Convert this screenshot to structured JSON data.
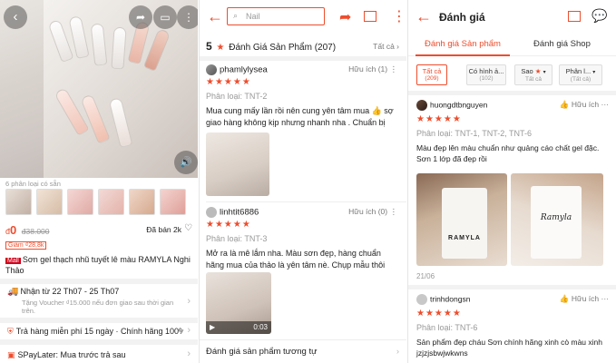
{
  "product": {
    "variant_count_label": "6 phân loại có sẵn",
    "price": "0",
    "price_currency": "đ",
    "original_price": "38.000",
    "original_currency": "đ",
    "sold": "Đã bán 2k",
    "discount_badge": "Giảm ₫28,8k",
    "mall_badge": "Mall",
    "title": "Sơn gel thạch nhũ tuyết lê màu RAMYLA Nghi Thảo",
    "shipping_title": "Nhận từ 22 Th07 - 25 Th07",
    "shipping_sub": "Tặng Voucher ₫15.000 nếu đơn giao sau thời gian trên.",
    "returns": "Trả hàng miễn phí 15 ngày · Chính hãng 100%...",
    "spaylater": "SPayLater: Mua trước trả sau"
  },
  "reviews_page": {
    "search_placeholder": "Nail",
    "rating": "5",
    "heading": "Đánh Giá Sản Phẩm (207)",
    "see_all": "Tất cả",
    "reviews": [
      {
        "user": "phamlylysea",
        "helpful": "Hữu ích (1)",
        "variant": "Phân loại: TNT-2",
        "text": "Mua cung mấy lần rồi nên cung yên tâm mua 👍 sợ giao hàng không kịp nhưng nhanh nha . Chuẩn bị hà..."
      },
      {
        "user": "linhtit6886",
        "helpful": "Hữu ích (0)",
        "variant": "Phân loại: TNT-3",
        "text": "Mở ra là mê lắm nha. Màu sơn đẹp, hàng chuẩn hãng mua của thảo là yên tâm nè. Chụp mẫu thôi chứ mua...",
        "video_duration": "0:03"
      }
    ],
    "similar": "Đánh giá sản phẩm tương tự"
  },
  "reviews_detail": {
    "title": "Đánh giá",
    "tab_product": "Đánh giá Sản phẩm",
    "tab_shop": "Đánh giá Shop",
    "chips": [
      {
        "label": "Tất cả",
        "sub": "(209)"
      },
      {
        "label": "Có hình ả...",
        "sub": "(102)"
      },
      {
        "label": "Sao",
        "sub": "Tất cả"
      },
      {
        "label": "Phân l...",
        "sub": "(Tất cả)"
      }
    ],
    "reviews": [
      {
        "user": "huongdtbnguyen",
        "helpful": "Hữu ích",
        "variant": "Phân loại: TNT-1, TNT-2, TNT-6",
        "text": "Màu đẹp lên màu chuẩn như quảng cáo chất gel đặc. Sơn 1 lớp đã đẹp rồi",
        "bottle_brand_1": "RAMYLA",
        "bottle_brand_2": "Ramyla",
        "date": "21/06"
      },
      {
        "user": "trinhdongsn",
        "helpful": "Hữu ích",
        "variant": "Phân loại: TNT-6",
        "text": "Sản phẩm đẹp cháu Sơn chính hãng xinh cò màu xinh jzjzjsbwjwkwns"
      }
    ]
  },
  "colors": {
    "accent": "#ee4d2d",
    "star": "#ee4d2d"
  }
}
